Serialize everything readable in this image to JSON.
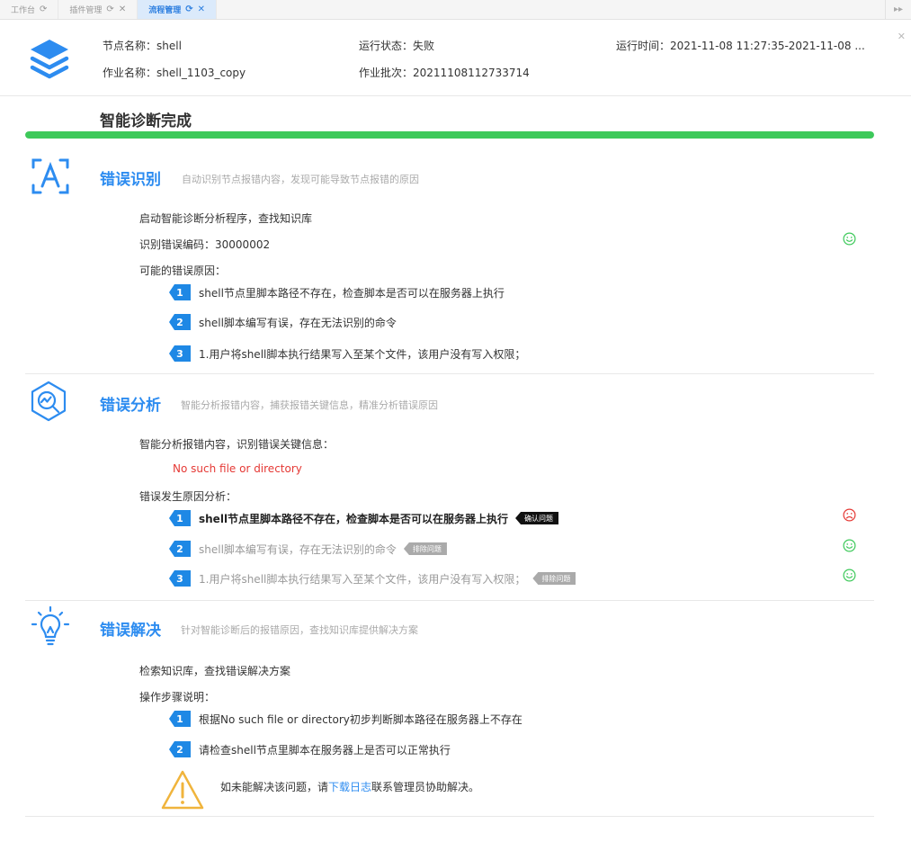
{
  "tabs": [
    {
      "label": "工作台",
      "active": false
    },
    {
      "label": "插件管理",
      "active": false
    },
    {
      "label": "流程管理",
      "active": true
    }
  ],
  "header": {
    "node_name_label": "节点名称：",
    "node_name": "shell",
    "run_status_label": "运行状态：",
    "run_status": "失败",
    "run_time_label": "运行时间：",
    "run_time": "2021-11-08 11:27:35-2021-11-08 ...",
    "job_name_label": "作业名称：",
    "job_name": "shell_1103_copy",
    "job_batch_label": "作业批次：",
    "job_batch": "20211108112733714"
  },
  "diagnosis": {
    "title": "智能诊断完成",
    "progress": 1.0,
    "progress_color": "#3dc95a"
  },
  "identify": {
    "title": "错误识别",
    "desc": "自动识别节点报错内容，发现可能导致节点报错的原因",
    "line1": "启动智能诊断分析程序，查找知识库",
    "code_label": "识别错误编码：",
    "code": "30000002",
    "reasons_label": "可能的错误原因：",
    "reasons": [
      {
        "num": "1",
        "text": "shell节点里脚本路径不存在，检查脚本是否可以在服务器上执行"
      },
      {
        "num": "2",
        "text": "shell脚本编写有误，存在无法识别的命令"
      },
      {
        "num": "3",
        "text": "1.用户将shell脚本执行结果写入至某个文件，该用户没有写入权限；"
      }
    ],
    "status": "happy"
  },
  "analysis": {
    "title": "错误分析",
    "desc": "智能分析报错内容，捕获报错关键信息，精准分析错误原因",
    "line1": "智能分析报错内容，识别错误关键信息：",
    "error_msg": "No such file or directory",
    "cause_label": "错误发生原因分析：",
    "causes": [
      {
        "num": "1",
        "text": "shell节点里脚本路径不存在，检查脚本是否可以在服务器上执行",
        "tag": "确认问题",
        "status": "sad"
      },
      {
        "num": "2",
        "text": "shell脚本编写有误，存在无法识别的命令",
        "tag": "排除问题",
        "status": "happy"
      },
      {
        "num": "3",
        "text": "1.用户将shell脚本执行结果写入至某个文件，该用户没有写入权限；",
        "tag": "排除问题",
        "status": "happy"
      }
    ]
  },
  "solution": {
    "title": "错误解决",
    "desc": "针对智能诊断后的报错原因，查找知识库提供解决方案",
    "line1": "检索知识库，查找错误解决方案",
    "steps_label": "操作步骤说明：",
    "steps": [
      {
        "num": "1",
        "text": "根据No such file or directory初步判断脚本路径在服务器上不存在"
      },
      {
        "num": "2",
        "text": "请检查shell节点里脚本在服务器上是否可以正常执行"
      }
    ],
    "warn_prefix": "如未能解决该问题，请",
    "warn_link": "下载日志",
    "warn_suffix": "联系管理员协助解决。"
  },
  "colors": {
    "accent": "#2d8cf0",
    "success": "#3dc95a",
    "danger": "#e53935",
    "badge": "#1e88e5"
  },
  "icons": {
    "layers": "layers-icon",
    "identify": "scan-text-icon",
    "analysis": "analysis-chart-icon",
    "solution": "lightbulb-icon",
    "warning": "warning-triangle-icon",
    "happy": "smile-icon",
    "sad": "frown-icon"
  }
}
